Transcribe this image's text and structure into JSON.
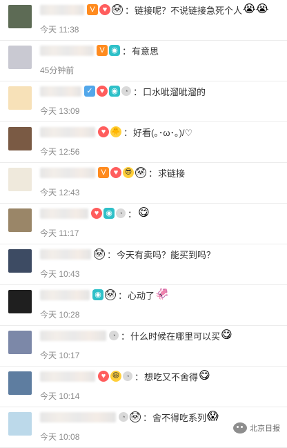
{
  "comments": [
    {
      "text": "链接呢？不说链接急死个人",
      "emoji": "😭😭",
      "time": "今天 11:38",
      "badges": [
        "vip",
        "fan",
        "panda"
      ],
      "avatar": "#5d6b55",
      "nameWidth": 64
    },
    {
      "text": "有意思",
      "emoji": "",
      "time": "45分钟前",
      "badges": [
        "vip",
        "cam"
      ],
      "avatar": "#c9c9d2",
      "nameWidth": 78
    },
    {
      "text": "口水呲溜呲溜的",
      "emoji": "",
      "time": "今天 13:09",
      "badges": [
        "blue",
        "fan",
        "cam",
        "watch"
      ],
      "avatar": "#f7e1b8",
      "nameWidth": 60
    },
    {
      "text": "好看(｡･ω･｡)/♡",
      "emoji": "",
      "time": "今天 12:56",
      "badges": [
        "fan",
        "duck"
      ],
      "avatar": "#7a5a44",
      "nameWidth": 80
    },
    {
      "text": "求链接",
      "emoji": "",
      "time": "今天 12:43",
      "badges": [
        "vip",
        "fan",
        "cool",
        "panda"
      ],
      "avatar": "#efe9dc",
      "nameWidth": 80
    },
    {
      "text": "",
      "emoji": "😋",
      "time": "今天 11:17",
      "badges": [
        "fan",
        "cam",
        "watch"
      ],
      "avatar": "#9a8668",
      "nameWidth": 70
    },
    {
      "text": "今天有卖吗？能买到吗？",
      "emoji": "",
      "time": "今天 10:43",
      "badges": [
        "panda"
      ],
      "avatar": "#3d4b63",
      "nameWidth": 74
    },
    {
      "text": "心动了",
      "emoji": "🦑",
      "time": "今天 10:28",
      "badges": [
        "cam",
        "panda"
      ],
      "avatar": "#1f1f1f",
      "nameWidth": 72
    },
    {
      "text": "什么时候在哪里可以买",
      "emoji": "😋",
      "time": "今天 10:17",
      "badges": [
        "watch"
      ],
      "avatar": "#7c88a8",
      "nameWidth": 96
    },
    {
      "text": "想吃又不舍得",
      "emoji": "😋",
      "time": "今天 10:14",
      "badges": [
        "fan",
        "grin",
        "watch"
      ],
      "avatar": "#5e7da0",
      "nameWidth": 80
    },
    {
      "text": "舍不得吃系列",
      "emoji": "😱",
      "time": "今天 10:08",
      "badges": [
        "watch",
        "panda"
      ],
      "avatar": "#bcd9ea",
      "nameWidth": 110
    }
  ],
  "watermark": "北京日报",
  "colon": "："
}
